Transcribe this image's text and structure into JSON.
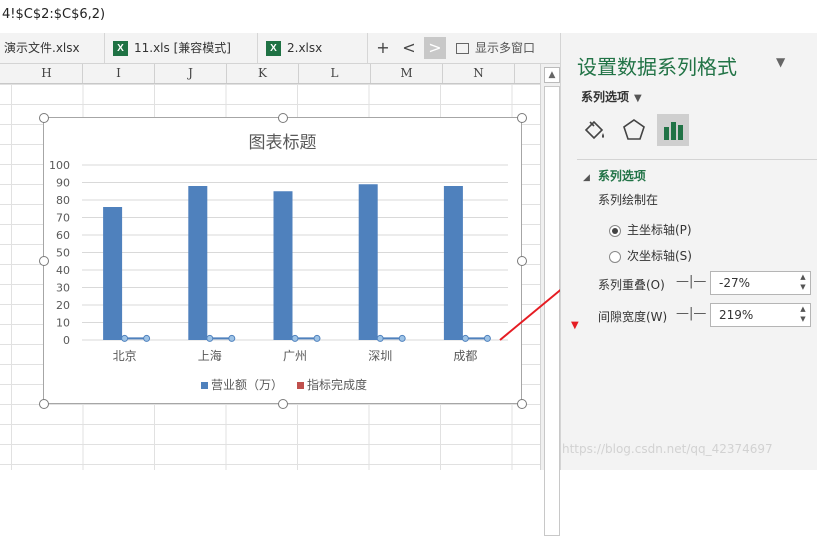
{
  "formula": "4!$C$2:$C$6,2)",
  "tabs": [
    {
      "label": "演示文件.xlsx",
      "icon": "none"
    },
    {
      "label": "11.xls  [兼容模式]",
      "icon": "excel-icon"
    },
    {
      "label": "2.xlsx",
      "icon": "excel-icon"
    }
  ],
  "tab_controls": {
    "add": "+",
    "prev": "<",
    "next": ">",
    "multi_window": "显示多窗口"
  },
  "columns": [
    "H",
    "I",
    "J",
    "K",
    "L",
    "M",
    "N"
  ],
  "chart_data": {
    "type": "bar",
    "title": "图表标题",
    "categories": [
      "北京",
      "上海",
      "广州",
      "深圳",
      "成都"
    ],
    "series": [
      {
        "name": "营业额（万）",
        "values": [
          76,
          88,
          85,
          89,
          88
        ],
        "color": "#4f81bd"
      },
      {
        "name": "指标完成度",
        "values": [
          0.9,
          0.9,
          0.9,
          0.9,
          0.9
        ],
        "color": "#c0504d",
        "display": "line-markers",
        "marker_color": "#4f81bd"
      }
    ],
    "ylim": [
      0,
      100
    ],
    "yticks": [
      0,
      10,
      20,
      30,
      40,
      50,
      60,
      70,
      80,
      90,
      100
    ],
    "grid": true,
    "legend_position": "bottom"
  },
  "panel": {
    "title": "设置数据系列格式",
    "dropdown_label": "系列选项",
    "icons": [
      "fill-bucket-icon",
      "pentagon-icon",
      "bar-chart-icon"
    ],
    "section": "系列选项",
    "plot_on_label": "系列绘制在",
    "primary_axis": "主坐标轴(P)",
    "secondary_axis": "次坐标轴(S)",
    "selected_axis": "primary",
    "overlap_label": "系列重叠(O)",
    "overlap_value": "-27%",
    "gap_label": "间隙宽度(W)",
    "gap_value": "219%"
  },
  "watermark": "https://blog.csdn.net/qq_42374697",
  "colors": {
    "accent": "#217346",
    "bar": "#4f81bd",
    "arrow": "#e51c23"
  }
}
